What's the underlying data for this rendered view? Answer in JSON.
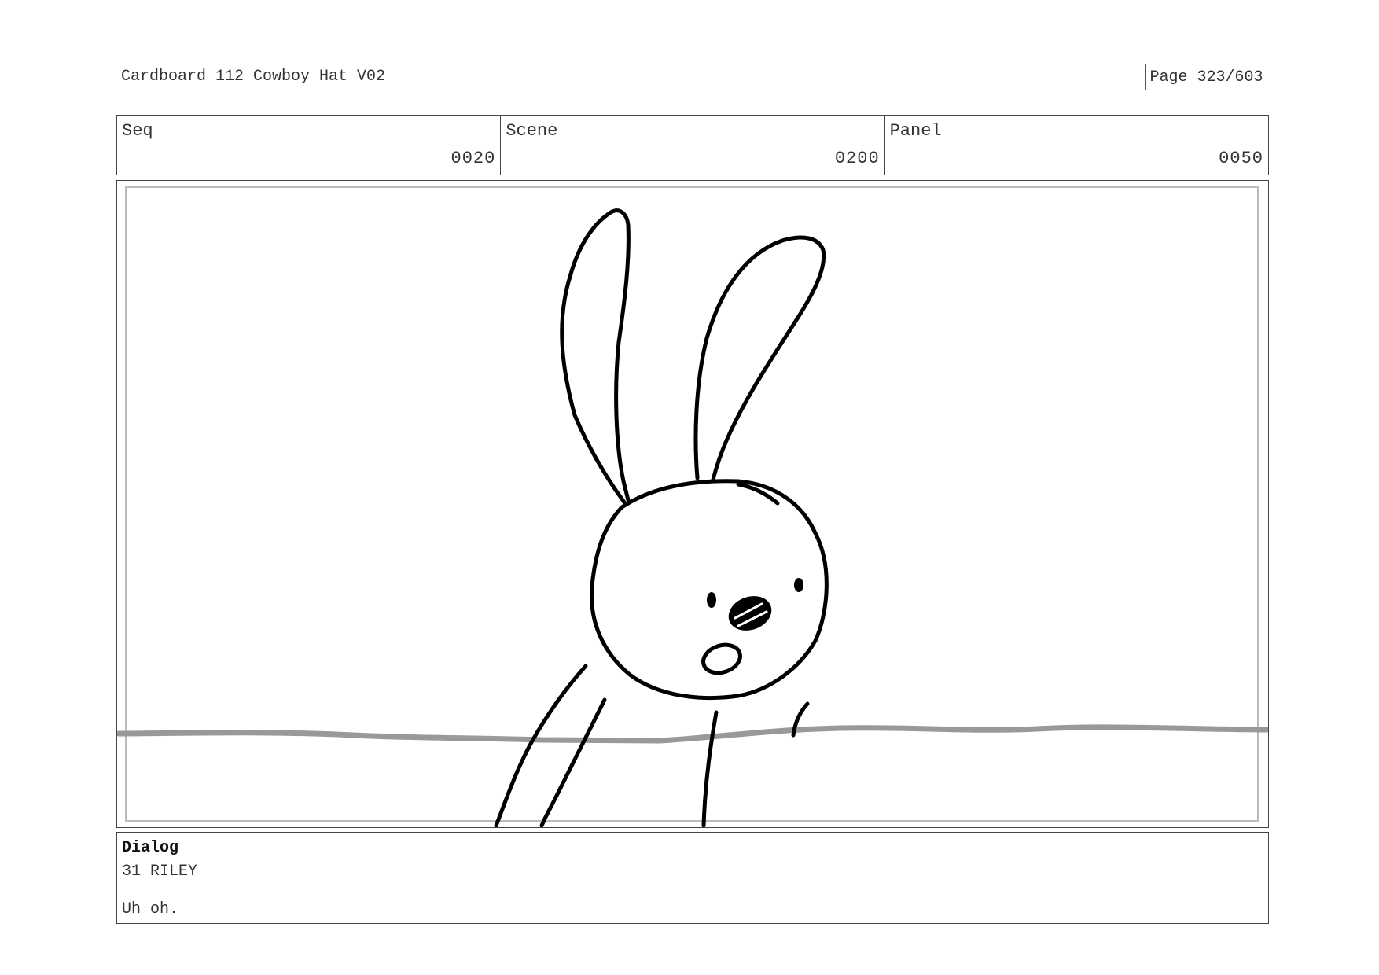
{
  "header": {
    "title": "Cardboard 112 Cowboy Hat V02",
    "page_label": "Page 323/603"
  },
  "info": {
    "seq_label": "Seq",
    "seq_value": "0020",
    "scene_label": "Scene",
    "scene_value": "0200",
    "panel_label": "Panel",
    "panel_value": "0050"
  },
  "frame": {
    "subject": "rabbit-sketch",
    "line_color": "#000000",
    "horizon_color": "#999999"
  },
  "dialog": {
    "heading": "Dialog",
    "speaker": "31 RILEY",
    "line": "Uh oh."
  }
}
